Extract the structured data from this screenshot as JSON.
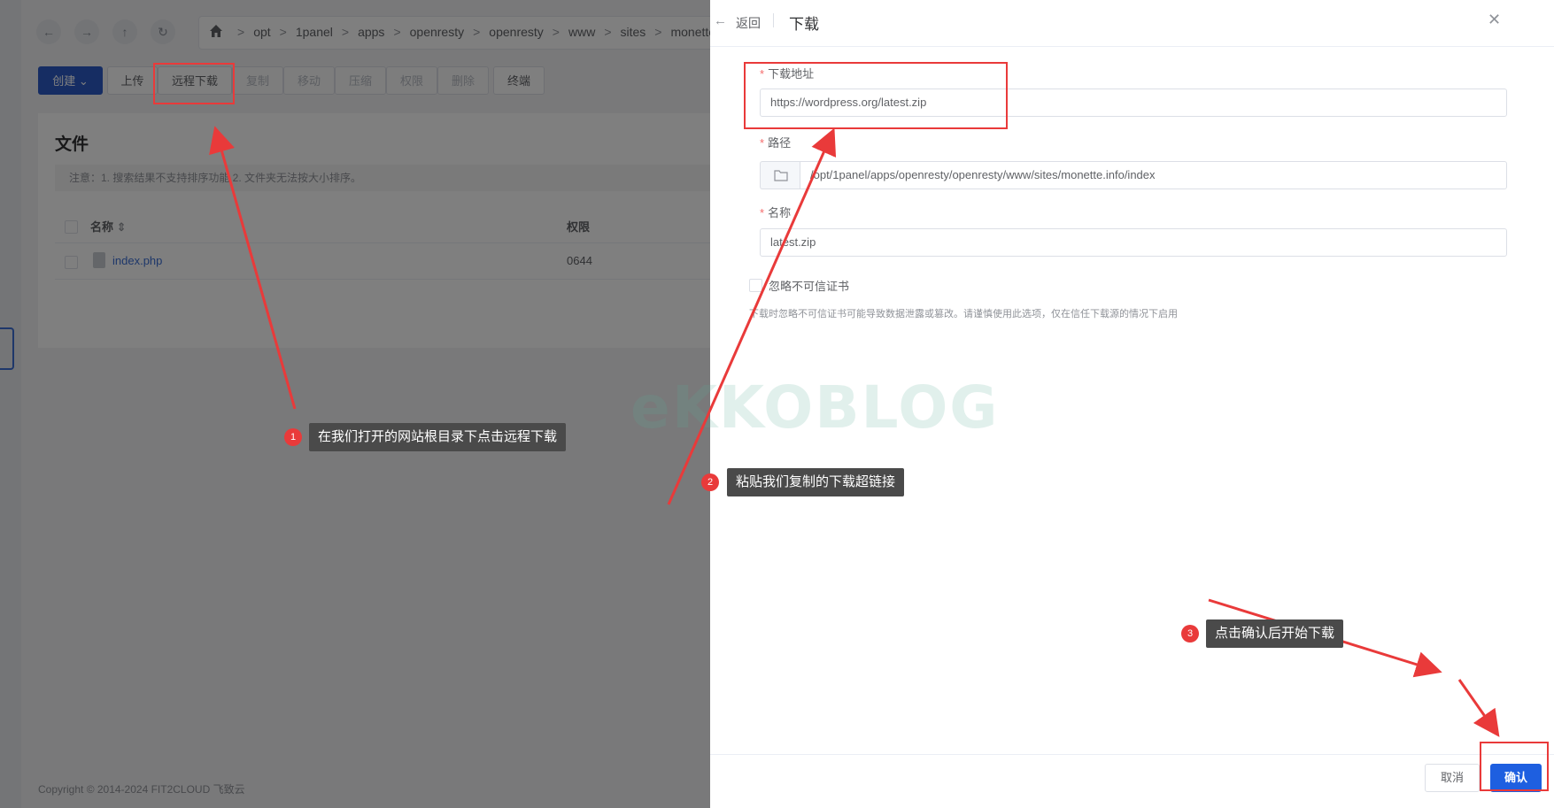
{
  "breadcrumb": [
    "opt",
    "1panel",
    "apps",
    "openresty",
    "openresty",
    "www",
    "sites",
    "monette.in"
  ],
  "toolbar": {
    "create": "创建",
    "upload": "上传",
    "remote_download": "远程下载",
    "copy": "复制",
    "move": "移动",
    "compress": "压缩",
    "permission": "权限",
    "delete": "删除",
    "terminal": "终端"
  },
  "files": {
    "title": "文件",
    "note": "注意：1. 搜索结果不支持排序功能 2. 文件夹无法按大小排序。",
    "col_name": "名称",
    "col_perm": "权限",
    "rows": [
      {
        "name": "index.php",
        "perm": "0644"
      }
    ]
  },
  "footer": {
    "copyright": "Copyright © 2014-2024 FIT2CLOUD 飞致云"
  },
  "drawer": {
    "back": "返回",
    "title": "下载",
    "url_label": "下载地址",
    "url_value": "https://wordpress.org/latest.zip",
    "path_label": "路径",
    "path_value": "/opt/1panel/apps/openresty/openresty/www/sites/monette.info/index",
    "name_label": "名称",
    "name_value": "latest.zip",
    "ignore_cert_label": "忽略不可信证书",
    "ignore_cert_hint": "下载时忽略不可信证书可能导致数据泄露或篡改。请谨慎使用此选项，仅在信任下载源的情况下启用",
    "cancel": "取消",
    "confirm": "确认"
  },
  "annotations": {
    "step1": {
      "num": "1",
      "text": "在我们打开的网站根目录下点击远程下载"
    },
    "step2": {
      "num": "2",
      "text": "粘贴我们复制的下载超链接"
    },
    "step3": {
      "num": "3",
      "text": "点击确认后开始下载"
    }
  },
  "watermark": "eKKOBLOG",
  "colors": {
    "primary": "#1e5fe0",
    "annotation_red": "#e93a3a",
    "required": "#f56c6c"
  }
}
